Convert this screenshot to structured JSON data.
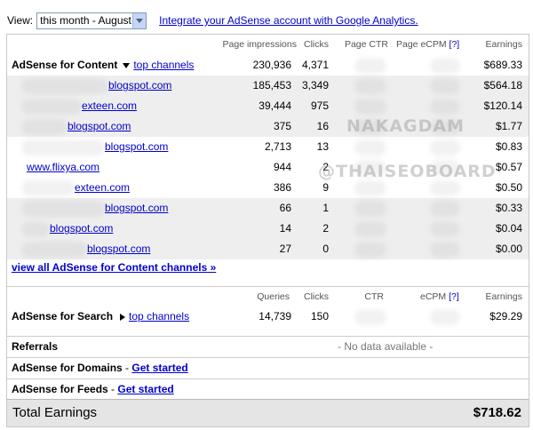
{
  "view_label": "View:",
  "period_select": {
    "value": "this month - August"
  },
  "integrate_link": "Integrate your AdSense account with Google Analytics.",
  "content": {
    "headers": {
      "impressions": "Page impressions",
      "clicks": "Clicks",
      "ctr": "Page CTR",
      "ecpm": "Page eCPM",
      "help": "[?]",
      "earnings": "Earnings"
    },
    "title": "AdSense for Content",
    "top_channels": "top channels",
    "summary": {
      "impressions": "230,936",
      "clicks": "4,371",
      "earnings": "$689.33"
    },
    "rows": [
      {
        "label": "blogspot.com",
        "impressions": "185,453",
        "clicks": "3,349",
        "earnings": "$564.18"
      },
      {
        "label": "exteen.com",
        "impressions": "39,444",
        "clicks": "975",
        "earnings": "$120.14"
      },
      {
        "label": "blogspot.com",
        "impressions": "375",
        "clicks": "16",
        "earnings": "$1.77"
      },
      {
        "label": "blogspot.com",
        "impressions": "2,713",
        "clicks": "13",
        "earnings": "$0.83"
      },
      {
        "label": "www.flixya.com",
        "impressions": "944",
        "clicks": "2",
        "earnings": "$0.57"
      },
      {
        "label": "exteen.com",
        "impressions": "386",
        "clicks": "9",
        "earnings": "$0.50"
      },
      {
        "label": "blogspot.com",
        "impressions": "66",
        "clicks": "1",
        "earnings": "$0.33"
      },
      {
        "label": "blogspot.com",
        "impressions": "14",
        "clicks": "2",
        "earnings": "$0.04"
      },
      {
        "label": "blogspot.com",
        "impressions": "27",
        "clicks": "0",
        "earnings": "$0.00"
      }
    ],
    "view_all": "view all AdSense for Content channels »"
  },
  "search": {
    "headers": {
      "queries": "Queries",
      "clicks": "Clicks",
      "ctr": "CTR",
      "ecpm": "eCPM",
      "help": "[?]",
      "earnings": "Earnings"
    },
    "title": "AdSense for Search",
    "top_channels": "top channels",
    "summary": {
      "queries": "14,739",
      "clicks": "150",
      "earnings": "$29.29"
    }
  },
  "referrals": {
    "title": "Referrals",
    "status": "- No data available -"
  },
  "domains": {
    "title": "AdSense for Domains",
    "dash": " - ",
    "link": "Get started"
  },
  "feeds": {
    "title": "AdSense for Feeds",
    "dash": " - ",
    "link": "Get started"
  },
  "total": {
    "label": "Total Earnings",
    "value": "$718.62"
  },
  "watermarks": {
    "line1": "NAKAGDAM",
    "line2": "@THAISEOBOARD"
  }
}
